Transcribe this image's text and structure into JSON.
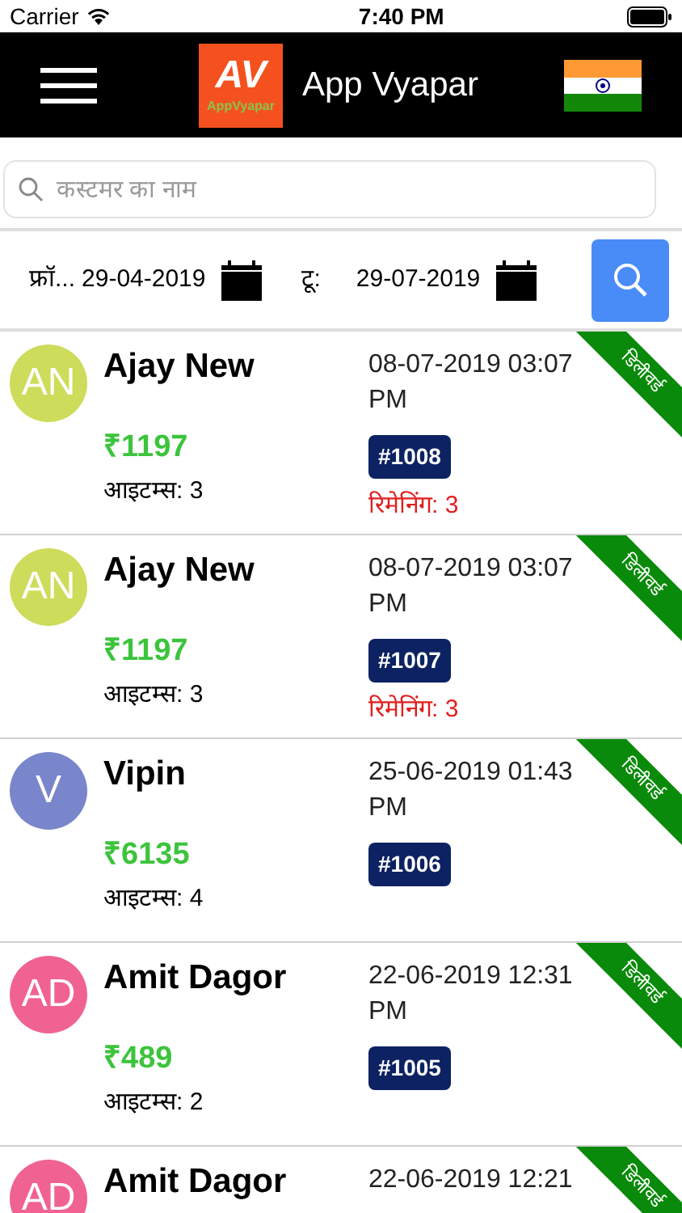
{
  "status_bar": {
    "carrier": "Carrier",
    "time": "7:40 PM"
  },
  "header": {
    "logo_letters": "AV",
    "logo_caption": "AppVyapar",
    "title": "App Vyapar"
  },
  "search": {
    "placeholder": "कस्टमर का नाम"
  },
  "date_filter": {
    "from_label": "फ्रॉ...",
    "from_date": "29-04-2019",
    "to_label": "टू:",
    "to_date": "29-07-2019"
  },
  "orders": [
    {
      "initials": "AN",
      "color": "#cddc5a",
      "name": "Ajay New",
      "datetime": "08-07-2019 03:07 PM",
      "amount": "₹1197",
      "items": "आइटम्स: 3",
      "order_no": "#1008",
      "remaining": "रिमेनिंग: 3",
      "status": "डिलीवर्ड"
    },
    {
      "initials": "AN",
      "color": "#cddc5a",
      "name": "Ajay New",
      "datetime": "08-07-2019 03:07 PM",
      "amount": "₹1197",
      "items": "आइटम्स: 3",
      "order_no": "#1007",
      "remaining": "रिमेनिंग: 3",
      "status": "डिलीवर्ड"
    },
    {
      "initials": "V",
      "color": "#7986cb",
      "name": "Vipin",
      "datetime": "25-06-2019 01:43 PM",
      "amount": "₹6135",
      "items": "आइटम्स: 4",
      "order_no": "#1006",
      "status": "डिलीवर्ड"
    },
    {
      "initials": "AD",
      "color": "#f06292",
      "name": "Amit Dagor",
      "datetime": "22-06-2019 12:31 PM",
      "amount": "₹489",
      "items": "आइटम्स: 2",
      "order_no": "#1005",
      "status": "डिलीवर्ड"
    },
    {
      "initials": "AD",
      "color": "#f06292",
      "name": "Amit Dagor",
      "datetime": "22-06-2019 12:21",
      "status": "डिलीवर्ड"
    }
  ]
}
